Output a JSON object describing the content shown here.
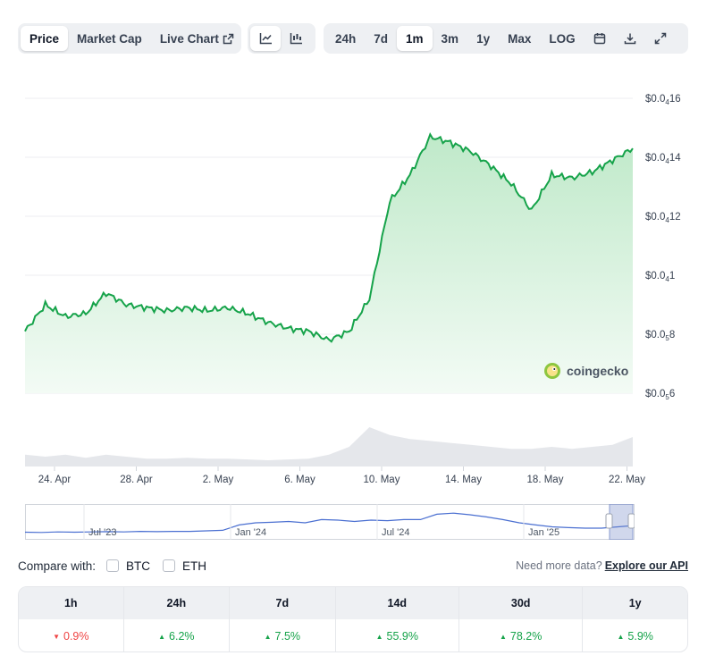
{
  "tabs": {
    "price": "Price",
    "market_cap": "Market Cap",
    "live_chart": "Live Chart"
  },
  "chart_type_buttons": [
    "line-chart-icon",
    "candlestick-chart-icon"
  ],
  "ranges": [
    "24h",
    "7d",
    "1m",
    "3m",
    "1y",
    "Max",
    "LOG"
  ],
  "active_range": "1m",
  "tools": [
    "calendar-icon",
    "download-icon",
    "expand-icon"
  ],
  "watermark": "coingecko",
  "chart_data": {
    "type": "area",
    "title": "",
    "xlabel": "",
    "ylabel": "",
    "y_tick_labels": [
      {
        "v": 1.6e-05,
        "base": "$0.0",
        "sub": "4",
        "rest": "16"
      },
      {
        "v": 1.4e-05,
        "base": "$0.0",
        "sub": "4",
        "rest": "14"
      },
      {
        "v": 1.2e-05,
        "base": "$0.0",
        "sub": "4",
        "rest": "12"
      },
      {
        "v": 1e-05,
        "base": "$0.0",
        "sub": "4",
        "rest": "1"
      },
      {
        "v": 8e-06,
        "base": "$0.0",
        "sub": "5",
        "rest": "8"
      },
      {
        "v": 6e-06,
        "base": "$0.0",
        "sub": "5",
        "rest": "6"
      }
    ],
    "ylim": [
      6e-06,
      1.6e-05
    ],
    "x_tick_labels": [
      "24. Apr",
      "28. Apr",
      "2. May",
      "6. May",
      "10. May",
      "14. May",
      "18. May",
      "22. May"
    ],
    "x": [
      "Apr 23",
      "Apr 24",
      "Apr 25",
      "Apr 26",
      "Apr 27",
      "Apr 28",
      "Apr 29",
      "Apr 30",
      "May 1",
      "May 2",
      "May 3",
      "May 4",
      "May 5",
      "May 6",
      "May 7",
      "May 8",
      "May 9",
      "May 10",
      "May 11",
      "May 12",
      "May 13",
      "May 14",
      "May 15",
      "May 16",
      "May 17",
      "May 18",
      "May 19",
      "May 20",
      "May 21",
      "May 22",
      "May 23"
    ],
    "series": [
      {
        "values": [
          8.1e-06,
          9e-06,
          8.6e-06,
          8.7e-06,
          9.4e-06,
          9e-06,
          8.9e-06,
          8.8e-06,
          8.9e-06,
          8.8e-06,
          8.9e-06,
          8.7e-06,
          8.4e-06,
          8.2e-06,
          8.1e-06,
          7.8e-06,
          8.1e-06,
          9.2e-06,
          1.25e-05,
          1.34e-05,
          1.47e-05,
          1.45e-05,
          1.42e-05,
          1.37e-05,
          1.31e-05,
          1.22e-05,
          1.34e-05,
          1.33e-05,
          1.35e-05,
          1.39e-05,
          1.43e-05
        ]
      }
    ],
    "volume": [
      0.3,
      0.25,
      0.3,
      0.22,
      0.3,
      0.25,
      0.2,
      0.2,
      0.22,
      0.2,
      0.2,
      0.18,
      0.16,
      0.18,
      0.2,
      0.3,
      0.5,
      1.0,
      0.8,
      0.7,
      0.65,
      0.6,
      0.55,
      0.5,
      0.45,
      0.45,
      0.5,
      0.45,
      0.5,
      0.55,
      0.75
    ],
    "grid": true,
    "legend": "none"
  },
  "navigator": {
    "labels": [
      "Jul '23",
      "Jan '24",
      "Jul '24",
      "Jan '25"
    ],
    "values": [
      0.15,
      0.14,
      0.16,
      0.15,
      0.16,
      0.17,
      0.16,
      0.18,
      0.17,
      0.18,
      0.18,
      0.2,
      0.22,
      0.42,
      0.5,
      0.52,
      0.55,
      0.5,
      0.62,
      0.6,
      0.55,
      0.6,
      0.58,
      0.62,
      0.62,
      0.82,
      0.86,
      0.8,
      0.72,
      0.62,
      0.5,
      0.42,
      0.35,
      0.32,
      0.3,
      0.3,
      0.35,
      0.4
    ]
  },
  "compare": {
    "label": "Compare with:",
    "options": [
      "BTC",
      "ETH"
    ],
    "more_text": "Need more data?",
    "more_link": "Explore our API"
  },
  "stats": [
    {
      "period": "1h",
      "value": "0.9%",
      "dir": "down"
    },
    {
      "period": "24h",
      "value": "6.2%",
      "dir": "up"
    },
    {
      "period": "7d",
      "value": "7.5%",
      "dir": "up"
    },
    {
      "period": "14d",
      "value": "55.9%",
      "dir": "up"
    },
    {
      "period": "30d",
      "value": "78.2%",
      "dir": "up"
    },
    {
      "period": "1y",
      "value": "5.9%",
      "dir": "up"
    }
  ],
  "colors": {
    "line": "#16a34a",
    "fill_top": "#bfe9c9",
    "fill_bottom": "#f3fbf5",
    "volume": "#e5e7eb",
    "up": "#16a34a",
    "down": "#ef4444"
  }
}
